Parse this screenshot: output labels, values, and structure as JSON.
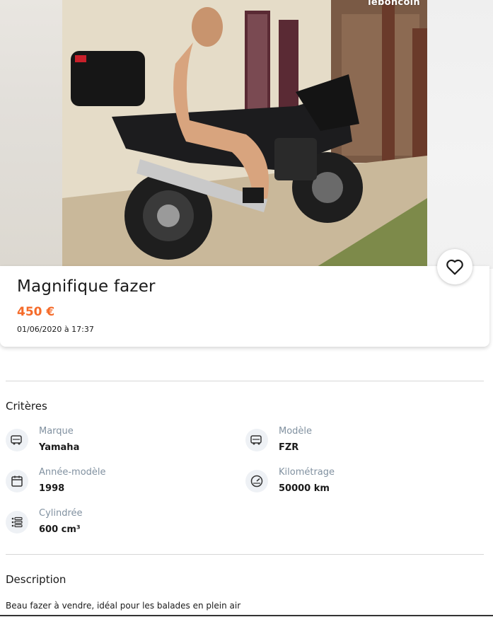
{
  "listing": {
    "title": "Magnifique fazer",
    "price": "450 €",
    "date": "01/06/2020 à 17:37",
    "photo_watermark": "leboncoin",
    "favorite_icon": "heart-outline-icon"
  },
  "criteria": {
    "heading": "Critères",
    "items": [
      {
        "label": "Marque",
        "value": "Yamaha",
        "icon": "car-icon"
      },
      {
        "label": "Modèle",
        "value": "FZR",
        "icon": "car-icon"
      },
      {
        "label": "Année-modèle",
        "value": "1998",
        "icon": "calendar-icon"
      },
      {
        "label": "Kilométrage",
        "value": "50000 km",
        "icon": "speedometer-icon"
      },
      {
        "label": "Cylindrée",
        "value": "600 cm³",
        "icon": "list-icon"
      }
    ]
  },
  "description": {
    "heading": "Description",
    "text": "Beau fazer à vendre, idéal pour les balades en plein air"
  },
  "colors": {
    "price": "#f56b2a",
    "label": "#8191a0",
    "icon_bg": "#eef1f5"
  }
}
